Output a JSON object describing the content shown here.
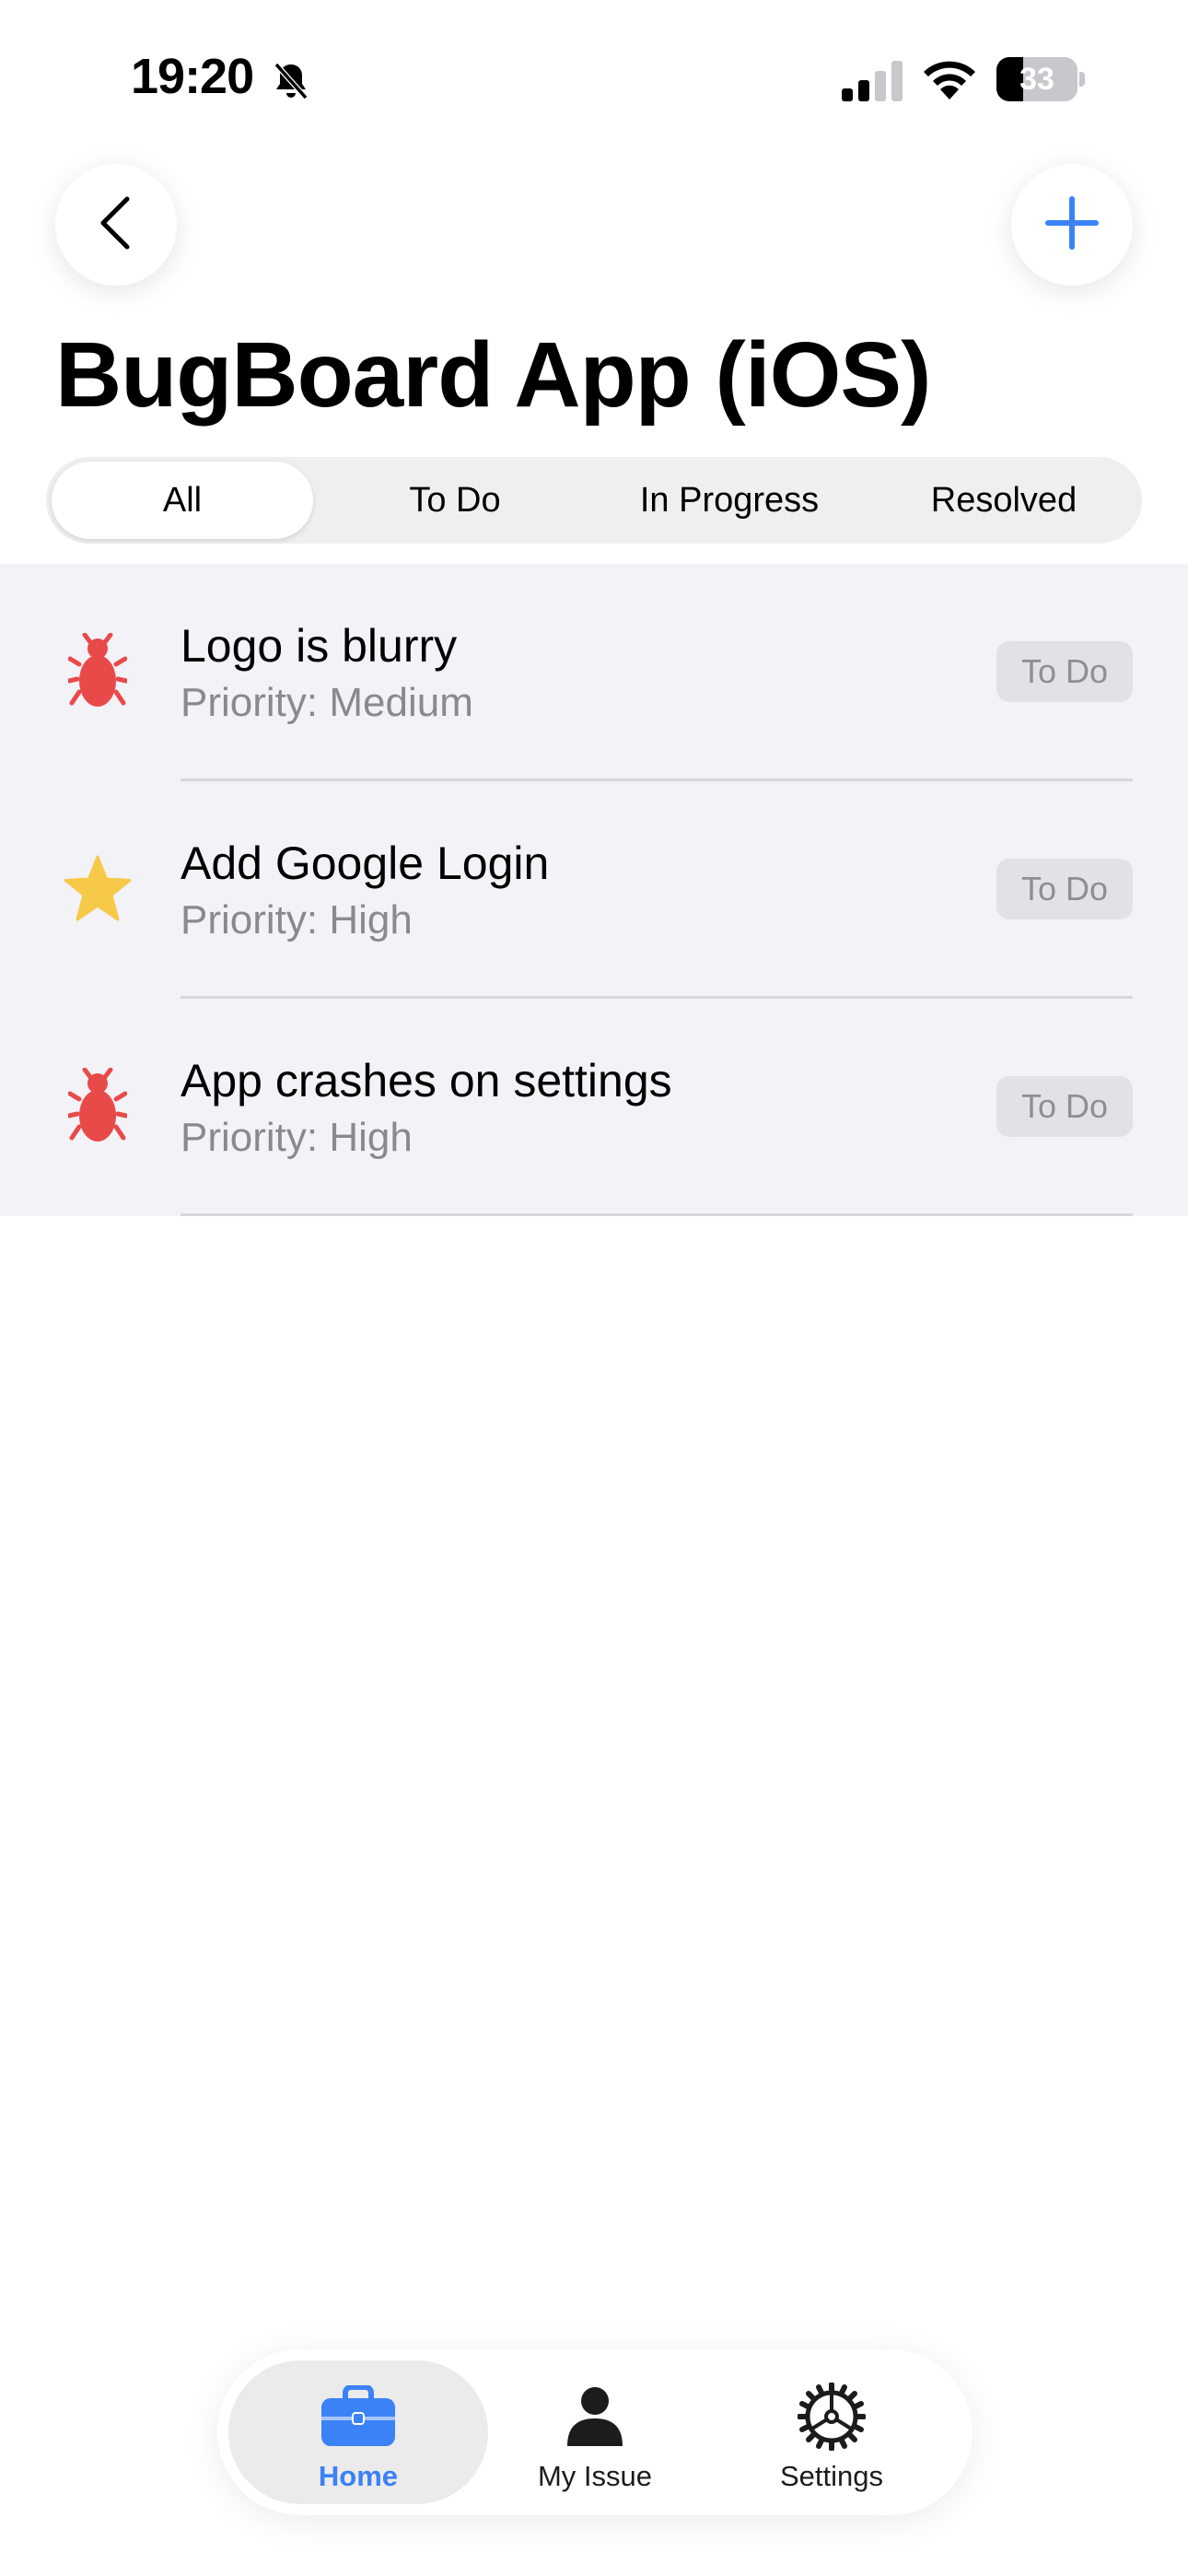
{
  "status_bar": {
    "time": "19:20",
    "battery": "33",
    "battery_percent": 33
  },
  "header": {
    "title": "BugBoard App (iOS)",
    "back_icon": "chevron-left-icon",
    "add_icon": "plus-icon",
    "accent_color": "#3b82f6"
  },
  "filter_tabs": {
    "selected": "All",
    "items": [
      "All",
      "To Do",
      "In Progress",
      "Resolved"
    ]
  },
  "issues": [
    {
      "title": "Logo is blurry",
      "priority": "Priority: Medium",
      "status": "To Do",
      "icon": "bug-icon",
      "icon_color": "#e84a4a"
    },
    {
      "title": "Add Google Login",
      "priority": "Priority: High",
      "status": "To Do",
      "icon": "star-icon",
      "icon_color": "#f7c948"
    },
    {
      "title": "App crashes on settings",
      "priority": "Priority: High",
      "status": "To Do",
      "icon": "bug-icon",
      "icon_color": "#e84a4a"
    }
  ],
  "tab_bar": {
    "items": [
      {
        "label": "Home",
        "icon": "briefcase-icon",
        "active": true
      },
      {
        "label": "My Issue",
        "icon": "person-icon",
        "active": false
      },
      {
        "label": "Settings",
        "icon": "gear-icon",
        "active": false
      }
    ]
  }
}
